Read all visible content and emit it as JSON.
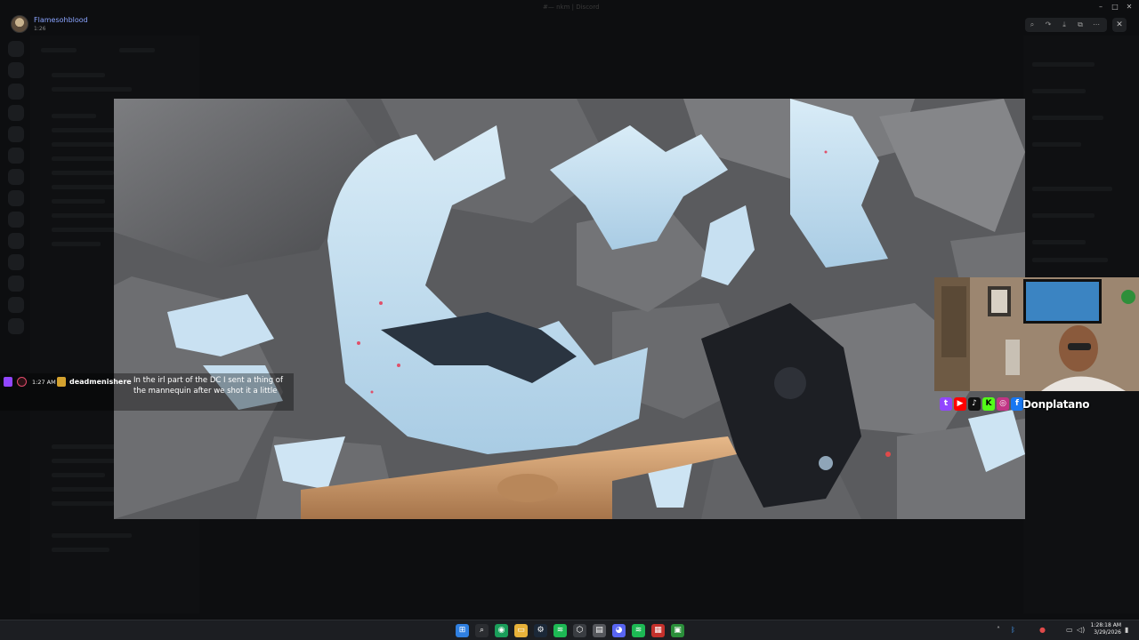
{
  "viewer": {
    "uploader": "Flamesohblood",
    "time": "1:26",
    "window_title": "#— nkm | Discord"
  },
  "chat": {
    "time": "1:27 AM",
    "username": "deadmenishere",
    "message": "In the irl part of the DC I sent a thing of the mannequin after we shot it a little"
  },
  "overlay": {
    "handle": "Donplatano"
  },
  "taskbar": {
    "clock_time": "1:28:18 AM",
    "clock_date": "3/29/2026"
  },
  "icons": [
    "window-minimize-icon",
    "window-maximize-icon",
    "window-close-icon",
    "zoom-icon",
    "forward-icon",
    "download-icon",
    "open-external-icon",
    "more-icon",
    "close-icon",
    "twitch-icon",
    "youtube-icon",
    "tiktok-icon",
    "kick-icon",
    "instagram-icon",
    "facebook-icon",
    "windows-start-icon",
    "search-icon",
    "chrome-icon",
    "explorer-icon",
    "steam-icon",
    "spotify-icon",
    "discord-icon"
  ],
  "colors": {
    "accent": "#8aa4ff",
    "twitch": "#9146ff",
    "taskbar": "#1c1e22"
  }
}
